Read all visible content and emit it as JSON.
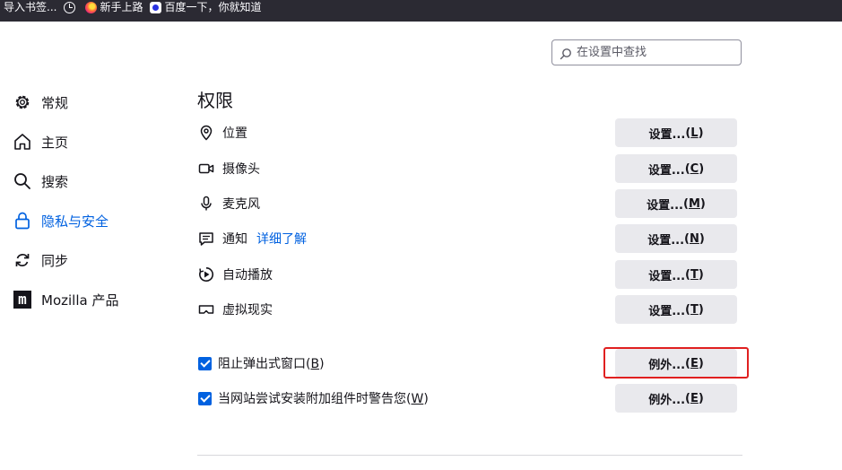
{
  "bookmarks": [
    {
      "label": "导入书签...",
      "icon": "none"
    },
    {
      "label": "",
      "icon": "history-icon"
    },
    {
      "label": "新手上路",
      "icon": "firefox-icon"
    },
    {
      "label": "百度一下，你就知道",
      "icon": "baidu-icon"
    }
  ],
  "search": {
    "placeholder": "在设置中查找",
    "icon": "search-icon"
  },
  "sidebar": {
    "items": [
      {
        "label": "常规",
        "icon": "gear-icon"
      },
      {
        "label": "主页",
        "icon": "home-icon"
      },
      {
        "label": "搜索",
        "icon": "search-icon"
      },
      {
        "label": "隐私与安全",
        "icon": "lock-icon",
        "selected": true
      },
      {
        "label": "同步",
        "icon": "sync-icon"
      },
      {
        "label": "Mozilla 产品",
        "icon": "mozilla-icon"
      }
    ]
  },
  "permissions": {
    "title": "权限",
    "rows": [
      {
        "label": "位置",
        "icon": "location-icon",
        "button": "设置...",
        "key": "L"
      },
      {
        "label": "摄像头",
        "icon": "camera-icon",
        "button": "设置...",
        "key": "C"
      },
      {
        "label": "麦克风",
        "icon": "microphone-icon",
        "button": "设置...",
        "key": "M"
      },
      {
        "label": "通知",
        "icon": "notification-icon",
        "link": "详细了解",
        "button": "设置...",
        "key": "N"
      },
      {
        "label": "自动播放",
        "icon": "autoplay-icon",
        "button": "设置...",
        "key": "T"
      },
      {
        "label": "虚拟现实",
        "icon": "vr-icon",
        "button": "设置...",
        "key": "T"
      }
    ],
    "checks": [
      {
        "label": "阻止弹出式窗口",
        "key": "B",
        "checked": true,
        "button": "例外...",
        "button_key": "E"
      },
      {
        "label": "当网站尝试安装附加组件时警告您",
        "key": "W",
        "checked": true,
        "button": "例外...",
        "button_key": "E"
      }
    ]
  },
  "colors": {
    "accent": "#0061e0",
    "highlight": "#e02020",
    "button_bg": "#e9e9ed",
    "toolbar_bg": "#2b2a33"
  }
}
